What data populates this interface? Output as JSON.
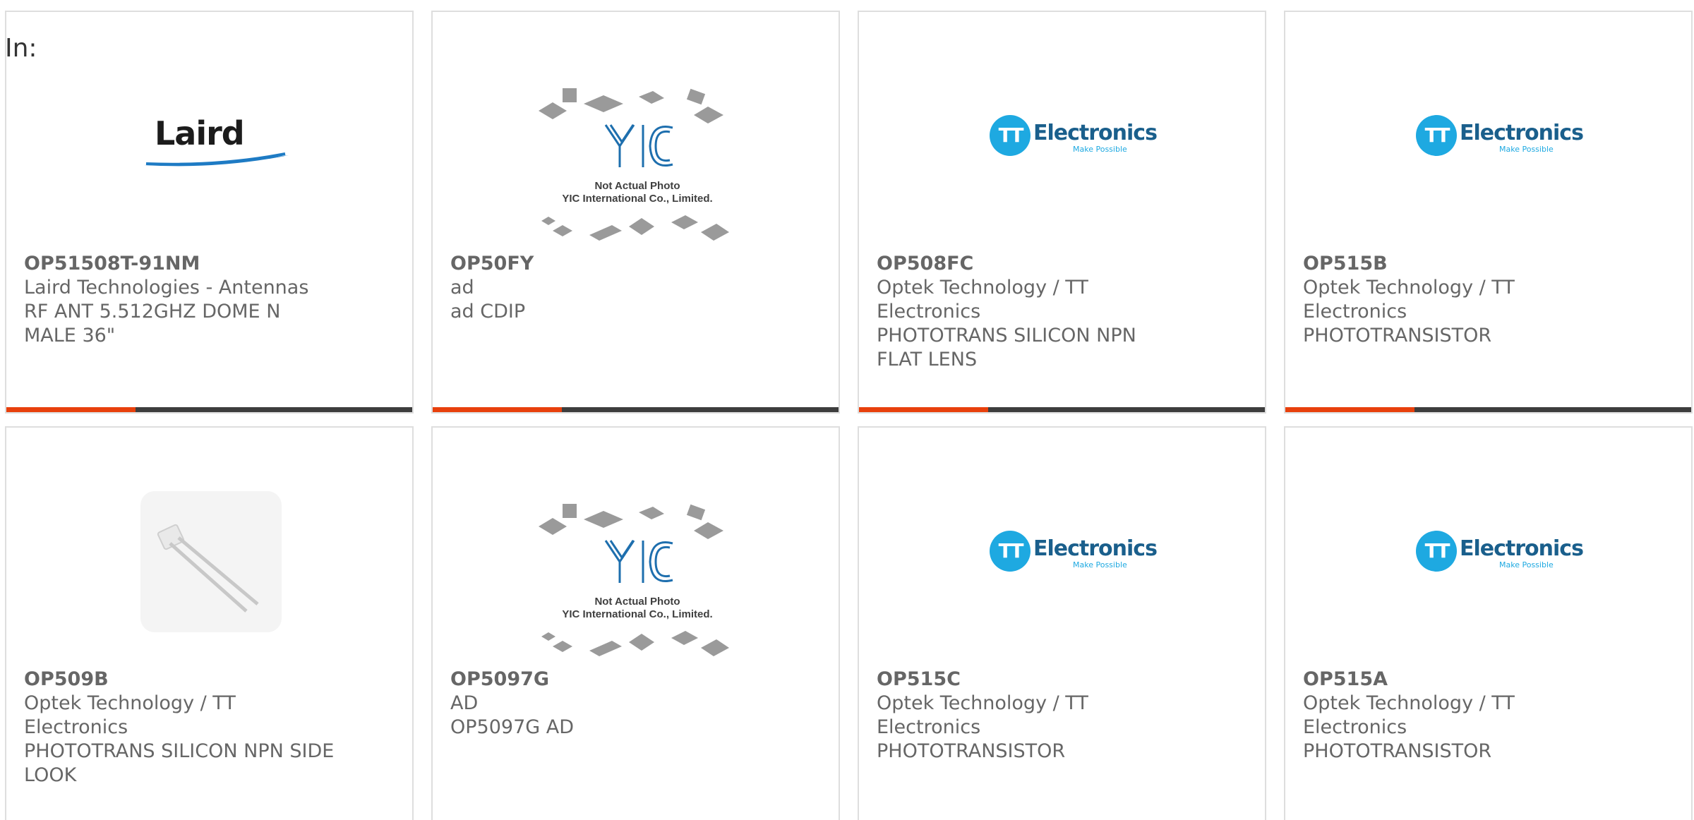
{
  "filter_label": "In:",
  "logos": {
    "tt_initials": "TT",
    "tt_word": "Electronics",
    "tt_tagline": "Make Possible",
    "laird_word": "Laird",
    "yic_line1": "Not Actual Photo",
    "yic_line2": "YIC International Co., Limited."
  },
  "colors": {
    "accent": "#e8400c",
    "bar": "#3d3d3d",
    "tt_blue": "#1ea9e1"
  },
  "products": [
    {
      "part_number": "OP51508T-91NM",
      "manufacturer": "Laird Technologies - Antennas",
      "description": "RF ANT 5.512GHZ DOME N MALE 36\"",
      "image": "laird-logo"
    },
    {
      "part_number": "OP50FY",
      "manufacturer": "ad",
      "description": "ad CDIP",
      "image": "yic-placeholder"
    },
    {
      "part_number": "OP508FC",
      "manufacturer": "Optek Technology / TT Electronics",
      "description": "PHOTOTRANS SILICON NPN FLAT LENS",
      "image": "tt-electronics-logo"
    },
    {
      "part_number": "OP515B",
      "manufacturer": "Optek Technology / TT Electronics",
      "description": "PHOTOTRANSISTOR",
      "image": "tt-electronics-logo"
    },
    {
      "part_number": "OP509B",
      "manufacturer": "Optek Technology / TT Electronics",
      "description": "PHOTOTRANS SILICON NPN SIDE LOOK",
      "image": "component-photo"
    },
    {
      "part_number": "OP5097G",
      "manufacturer": "AD",
      "description": "OP5097G AD",
      "image": "yic-placeholder"
    },
    {
      "part_number": "OP515C",
      "manufacturer": "Optek Technology / TT Electronics",
      "description": "PHOTOTRANSISTOR",
      "image": "tt-electronics-logo"
    },
    {
      "part_number": "OP515A",
      "manufacturer": "Optek Technology / TT Electronics",
      "description": "PHOTOTRANSISTOR",
      "image": "tt-electronics-logo"
    }
  ]
}
